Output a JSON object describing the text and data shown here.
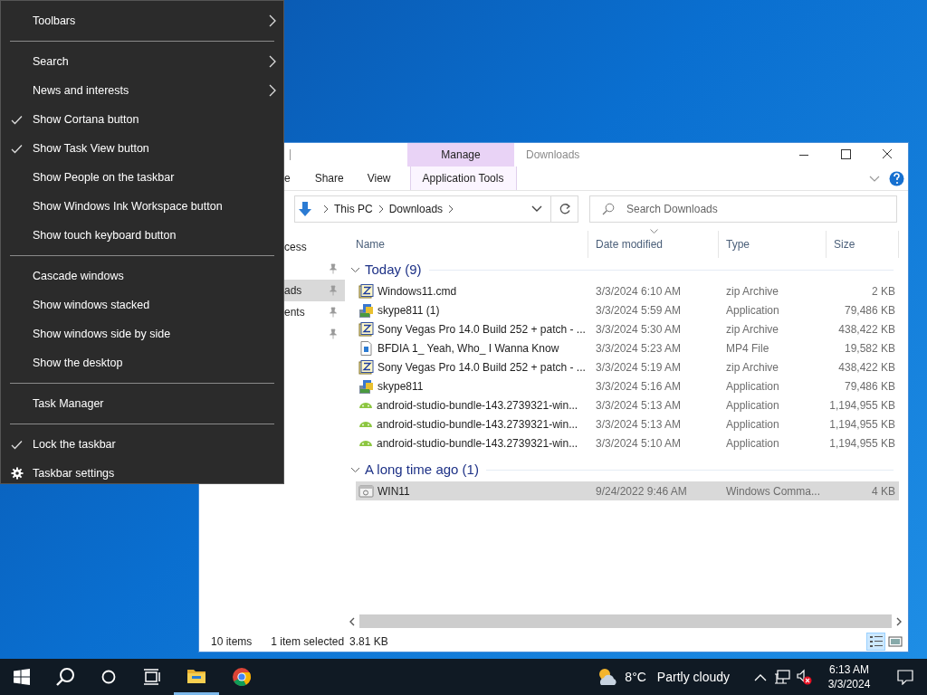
{
  "context_menu": {
    "sections": [
      [
        {
          "label": "Toolbars",
          "kind": "submenu",
          "checked": false
        }
      ],
      [
        {
          "label": "Search",
          "kind": "submenu",
          "checked": false
        },
        {
          "label": "News and interests",
          "kind": "submenu",
          "checked": false
        },
        {
          "label": "Show Cortana button",
          "kind": "toggle",
          "checked": true
        },
        {
          "label": "Show Task View button",
          "kind": "toggle",
          "checked": true
        },
        {
          "label": "Show People on the taskbar",
          "kind": "toggle",
          "checked": false
        },
        {
          "label": "Show Windows Ink Workspace button",
          "kind": "toggle",
          "checked": false
        },
        {
          "label": "Show touch keyboard button",
          "kind": "toggle",
          "checked": false
        }
      ],
      [
        {
          "label": "Cascade windows",
          "kind": "command",
          "checked": false
        },
        {
          "label": "Show windows stacked",
          "kind": "command",
          "checked": false
        },
        {
          "label": "Show windows side by side",
          "kind": "command",
          "checked": false
        },
        {
          "label": "Show the desktop",
          "kind": "command",
          "checked": false
        }
      ],
      [
        {
          "label": "Task Manager",
          "kind": "command",
          "checked": false
        }
      ],
      [
        {
          "label": "Lock the taskbar",
          "kind": "toggle",
          "checked": true
        },
        {
          "label": "Taskbar settings",
          "kind": "settings",
          "checked": false
        }
      ]
    ]
  },
  "explorer": {
    "title": "Downloads",
    "context_tab": {
      "group": "Manage",
      "tab": "Application Tools"
    },
    "ribbon_tabs": [
      {
        "label": "e",
        "selected": false
      },
      {
        "label": "Share",
        "selected": false
      },
      {
        "label": "View",
        "selected": false
      }
    ],
    "address": {
      "crumbs": [
        "This PC",
        "Downloads"
      ]
    },
    "search": {
      "placeholder": "Search Downloads"
    },
    "nav_items": [
      {
        "label": "cess",
        "pinned": false,
        "selected": false
      },
      {
        "pinned": true,
        "selected": false
      },
      {
        "label": "ads",
        "pinned": true,
        "selected": true
      },
      {
        "label": "ents",
        "pinned": true,
        "selected": false
      },
      {
        "pinned": true,
        "selected": false
      }
    ],
    "columns": [
      "Name",
      "Date modified",
      "Type",
      "Size"
    ],
    "groups": [
      {
        "label": "Today (9)",
        "expanded": true,
        "rows": [
          {
            "kind": "zip",
            "name": "Windows11.cmd",
            "date": "3/3/2024 6:10 AM",
            "type": "zip Archive",
            "size": "2 KB",
            "selected": false
          },
          {
            "kind": "installer",
            "name": "skype811 (1)",
            "date": "3/3/2024 5:59 AM",
            "type": "Application",
            "size": "79,486 KB",
            "selected": false
          },
          {
            "kind": "zip",
            "name": "Sony Vegas Pro 14.0 Build 252 + patch - ...",
            "date": "3/3/2024 5:30 AM",
            "type": "zip Archive",
            "size": "438,422 KB",
            "selected": false
          },
          {
            "kind": "video",
            "name": "BFDIA 1_ Yeah, Who_ I Wanna Know",
            "date": "3/3/2024 5:23 AM",
            "type": "MP4 File",
            "size": "19,582 KB",
            "selected": false
          },
          {
            "kind": "zip",
            "name": "Sony Vegas Pro 14.0 Build 252 + patch - ...",
            "date": "3/3/2024 5:19 AM",
            "type": "zip Archive",
            "size": "438,422 KB",
            "selected": false
          },
          {
            "kind": "installer",
            "name": "skype811",
            "date": "3/3/2024 5:16 AM",
            "type": "Application",
            "size": "79,486 KB",
            "selected": false
          },
          {
            "kind": "android",
            "name": "android-studio-bundle-143.2739321-win...",
            "date": "3/3/2024 5:13 AM",
            "type": "Application",
            "size": "1,194,955 KB",
            "selected": false
          },
          {
            "kind": "android",
            "name": "android-studio-bundle-143.2739321-win...",
            "date": "3/3/2024 5:13 AM",
            "type": "Application",
            "size": "1,194,955 KB",
            "selected": false
          },
          {
            "kind": "android",
            "name": "android-studio-bundle-143.2739321-win...",
            "date": "3/3/2024 5:10 AM",
            "type": "Application",
            "size": "1,194,955 KB",
            "selected": false
          }
        ]
      },
      {
        "label": "A long time ago (1)",
        "expanded": true,
        "rows": [
          {
            "kind": "script",
            "name": "WIN11",
            "date": "9/24/2022 9:46 AM",
            "type": "Windows Comma...",
            "size": "4 KB",
            "selected": true
          }
        ]
      }
    ],
    "status_bar": {
      "items": "10 items",
      "selection": "1 item selected",
      "selection_size": "3.81 KB"
    },
    "views": [
      {
        "kind": "details",
        "selected": true
      },
      {
        "kind": "tiles",
        "selected": false
      }
    ]
  },
  "taskbar": {
    "apps": [
      {
        "kind": "explorer",
        "active": true
      },
      {
        "kind": "chrome",
        "active": false
      }
    ],
    "weather": {
      "temperature": "8°C",
      "condition": "Partly cloudy"
    },
    "clock": {
      "time": "6:13 AM",
      "date": "3/3/2024"
    }
  }
}
